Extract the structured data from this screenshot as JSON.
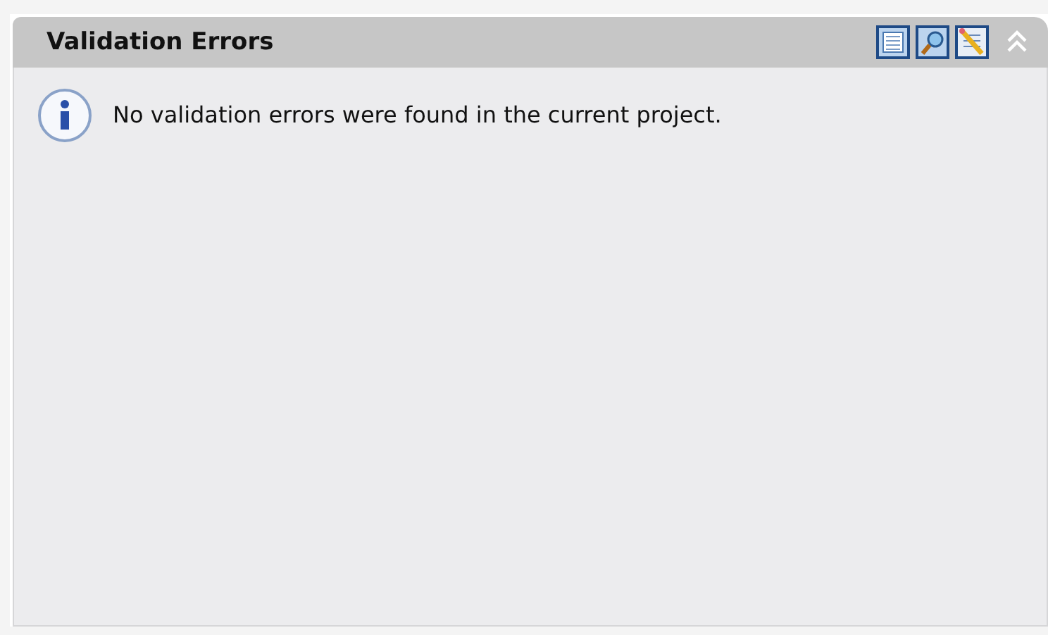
{
  "panel": {
    "title": "Validation Errors",
    "message": "No validation errors were found in the current project."
  }
}
